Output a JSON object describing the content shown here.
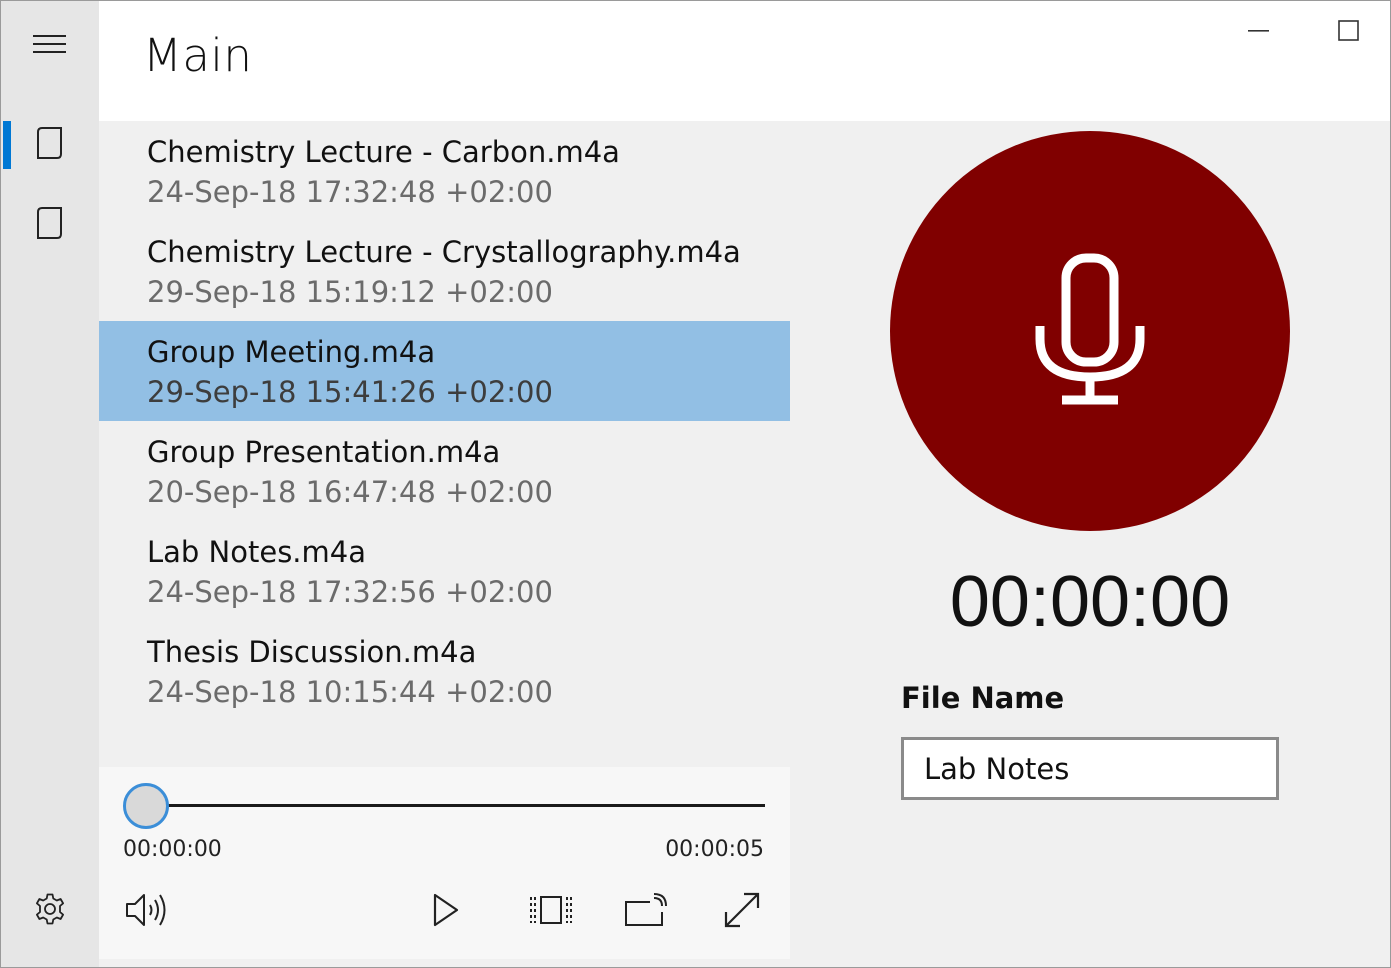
{
  "header": {
    "title": "Main"
  },
  "nav": {
    "items": [
      {
        "icon": "hamburger-icon"
      },
      {
        "icon": "page-icon",
        "selected": true
      },
      {
        "icon": "page-icon",
        "selected": false
      },
      {
        "icon": "gear-icon"
      }
    ],
    "accent": "#0078d4"
  },
  "files": [
    {
      "name": "Chemistry Lecture - Carbon.m4a",
      "date": "24-Sep-18 17:32:48 +02:00",
      "selected": false
    },
    {
      "name": "Chemistry Lecture - Crystallography.m4a",
      "date": "29-Sep-18 15:19:12 +02:00",
      "selected": false
    },
    {
      "name": "Group Meeting.m4a",
      "date": "29-Sep-18 15:41:26 +02:00",
      "selected": true
    },
    {
      "name": "Group Presentation.m4a",
      "date": "20-Sep-18 16:47:48 +02:00",
      "selected": false
    },
    {
      "name": "Lab Notes.m4a",
      "date": "24-Sep-18 17:32:56 +02:00",
      "selected": false
    },
    {
      "name": "Thesis Discussion.m4a",
      "date": "24-Sep-18 10:15:44 +02:00",
      "selected": false
    }
  ],
  "player": {
    "elapsed": "00:00:00",
    "total": "00:00:05",
    "progress": 0,
    "controls": [
      "volume-icon",
      "play-icon",
      "aspect-ratio-icon",
      "cast-icon",
      "fullscreen-icon"
    ]
  },
  "recorder": {
    "timer": "00:00:00",
    "button_color": "#800000",
    "file_name_label": "File Name",
    "file_name_value": "Lab Notes"
  },
  "colors": {
    "selection": "#92bfe4",
    "seek_thumb_border": "#3b8ed8"
  }
}
